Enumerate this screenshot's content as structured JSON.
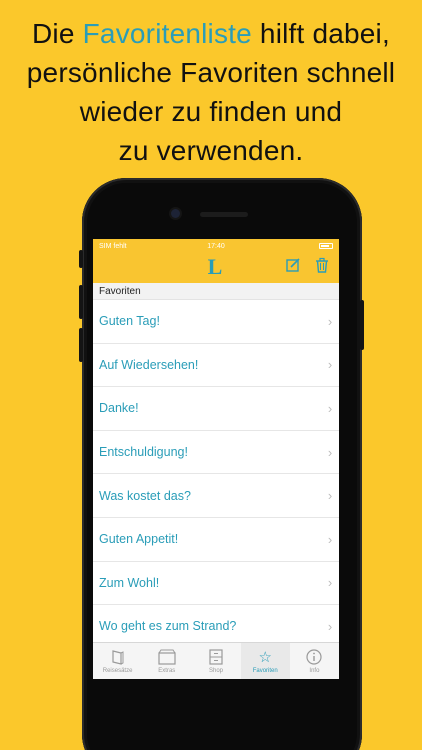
{
  "headline": {
    "part1": "Die",
    "highlight": "Favoritenliste",
    "part2": "hilft dabei,",
    "line2": "persönliche Favoriten schnell",
    "line3": "wieder zu finden und",
    "line4": "zu verwenden."
  },
  "colors": {
    "background": "#fbc82b",
    "accent": "#2a9db8",
    "navbar": "#f9c530"
  },
  "status_bar": {
    "carrier": "SIM fehlt",
    "time": "17:40"
  },
  "navbar": {
    "logo": "L",
    "edit_icon": "compose-icon",
    "delete_icon": "trash-icon"
  },
  "section": {
    "title": "Favoriten"
  },
  "favorites": [
    "Guten Tag!",
    "Auf Wiedersehen!",
    "Danke!",
    "Entschuldigung!",
    "Was kostet das?",
    "Guten Appetit!",
    "Zum Wohl!",
    "Wo geht es zum Strand?"
  ],
  "tabbar": {
    "tabs": [
      {
        "label": "Reisesätze",
        "icon": "book-icon",
        "active": false
      },
      {
        "label": "Extras",
        "icon": "folder-icon",
        "active": false
      },
      {
        "label": "Shop",
        "icon": "shop-icon",
        "active": false
      },
      {
        "label": "Favoriten",
        "icon": "star-icon",
        "active": true
      },
      {
        "label": "Info",
        "icon": "info-icon",
        "active": false
      }
    ]
  }
}
